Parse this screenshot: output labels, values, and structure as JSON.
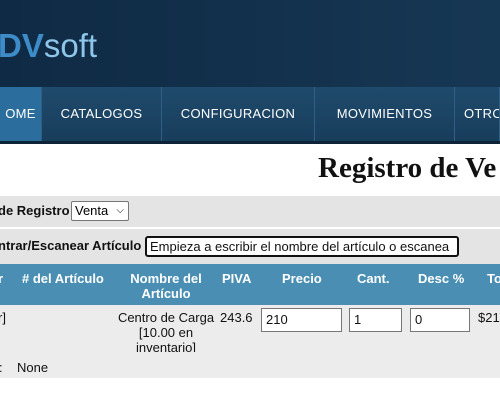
{
  "brand": {
    "light_part": "D",
    "dark_part": "V",
    "suffix": "soft"
  },
  "nav": {
    "items": [
      {
        "label": "OME",
        "active": true
      },
      {
        "label": "CATALOGOS",
        "active": false
      },
      {
        "label": "CONFIGURACION",
        "active": false
      },
      {
        "label": "MOVIMIENTOS",
        "active": false
      },
      {
        "label": "OTRO",
        "active": false
      }
    ]
  },
  "page_title": "Registro de Ve",
  "registro": {
    "label": "de Registro",
    "selected": "Venta"
  },
  "scan": {
    "label": "ntrar/Escanear Artículo",
    "placeholder": "Empieza a escribir el nombre del artículo o escanea"
  },
  "table": {
    "headers": [
      "r",
      "# del Artículo",
      "Nombre del Artículo",
      "PIVA",
      "Precio",
      "Cant.",
      "Desc %",
      "To"
    ],
    "row": {
      "col0": "r]",
      "nombre_line1": "Centro de Carga",
      "nombre_line2": "[10.00 en",
      "nombre_line3": "inventario]",
      "piva": "243.6",
      "precio": "210",
      "cant": "1",
      "desc": "0",
      "total": "$21"
    },
    "footer": {
      "label": ":",
      "value": "None"
    }
  },
  "colors": {
    "header_bg": "#0f2a44",
    "nav_bg": "#1f4a6c",
    "nav_active": "#2b6d9c",
    "table_head": "#4a8fb3"
  }
}
